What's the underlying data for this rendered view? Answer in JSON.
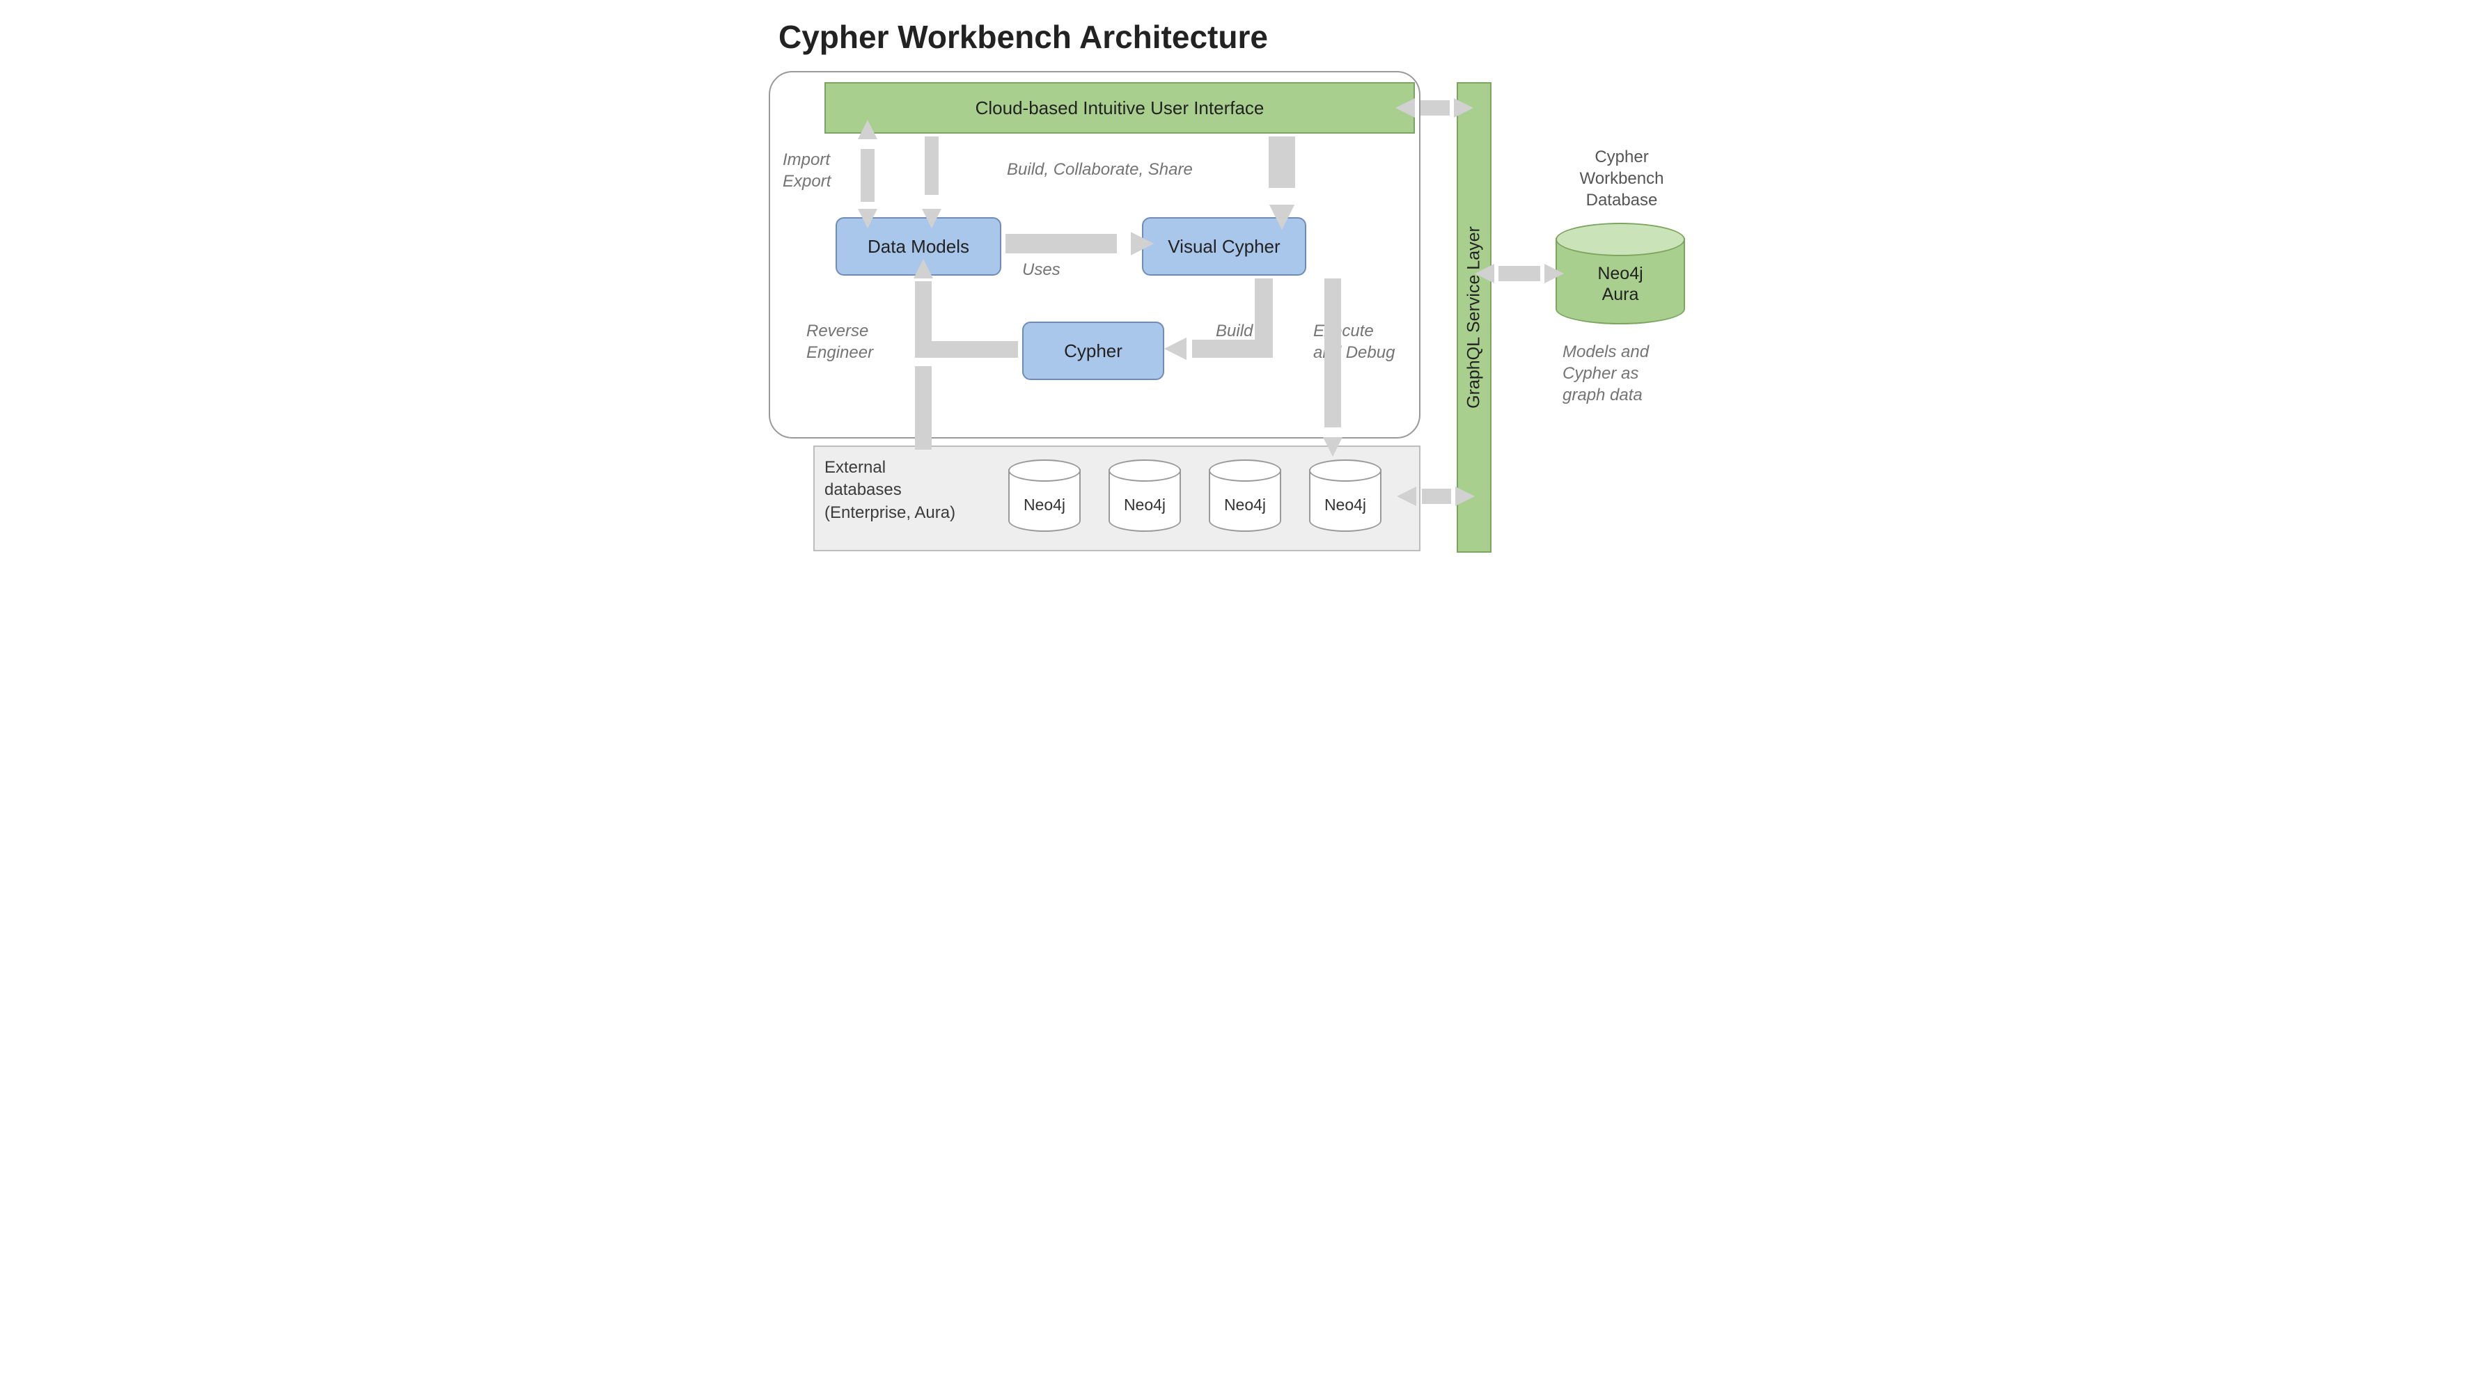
{
  "title": "Cypher Workbench Architecture",
  "ui_bar": "Cloud-based Intuitive User Interface",
  "boxes": {
    "data_models": "Data Models",
    "visual_cypher": "Visual Cypher",
    "cypher": "Cypher"
  },
  "annotations": {
    "import_export": "Import\nExport",
    "build_collab": "Build, Collaborate, Share",
    "uses": "Uses",
    "build": "Build",
    "exec_debug": "Execute\nand Debug",
    "rev_eng": "Reverse\nEngineer"
  },
  "external": {
    "label": "External\ndatabases\n(Enterprise, Aura)",
    "db_label": "Neo4j"
  },
  "service_layer": "GraphQL Service Layer",
  "right": {
    "header": "Cypher\nWorkbench\nDatabase",
    "cylinder": "Neo4j\nAura",
    "caption": "Models and\nCypher as\ngraph data"
  }
}
